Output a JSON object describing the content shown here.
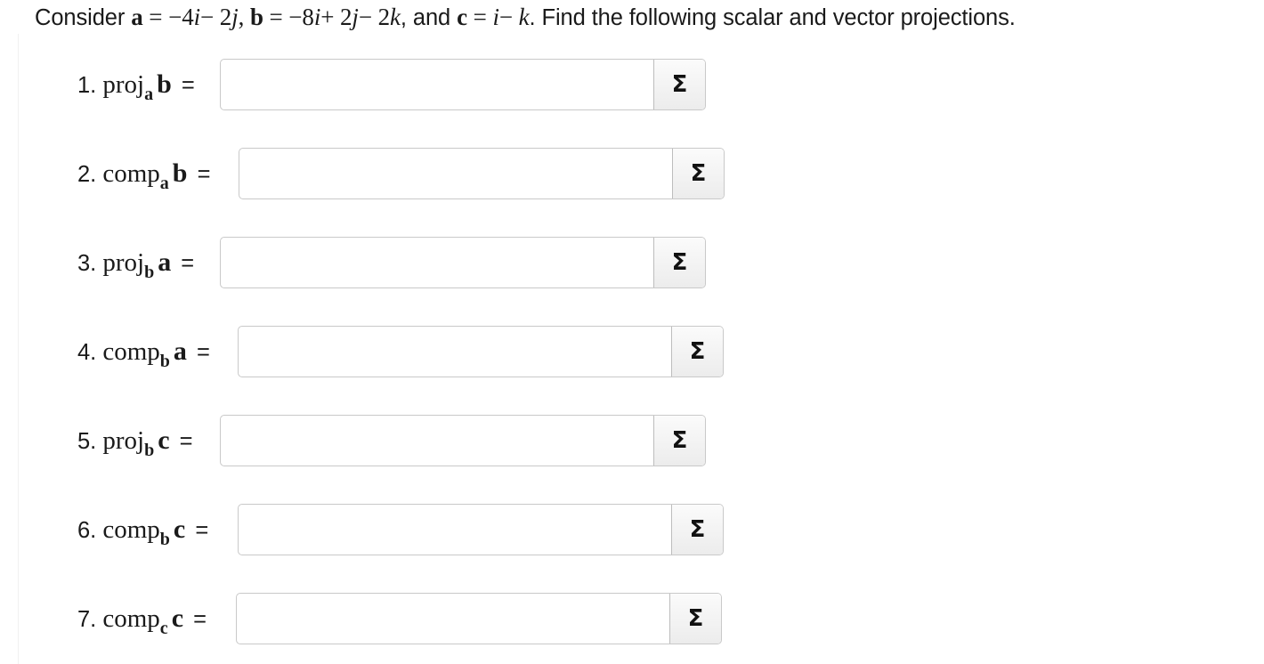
{
  "header": {
    "t1": "Consider ",
    "a": "a",
    "eq1": " = ",
    "a_expr_1": "−4",
    "i1": "i",
    "a_expr_2": "− 2",
    "j1": "j",
    "comma1": ", ",
    "b": "b",
    "eq2": " = ",
    "b_expr_1": "−8",
    "i2": "i",
    "b_expr_2": "+ 2",
    "j2": "j",
    "b_expr_3": "− 2",
    "k1": "k",
    "t2": ", and ",
    "c": "c",
    "eq3": " = ",
    "i3": "i",
    "c_expr_1": "− ",
    "k2": "k",
    "t3": ". Find the following scalar and vector projections."
  },
  "problems": [
    {
      "num": "1. ",
      "fn": "proj",
      "sub": "a",
      "vec": "b",
      "eq": "=",
      "value": ""
    },
    {
      "num": "2. ",
      "fn": "comp",
      "sub": "a",
      "vec": "b",
      "eq": "=",
      "value": ""
    },
    {
      "num": "3. ",
      "fn": "proj",
      "sub": "b",
      "vec": "a",
      "eq": "=",
      "value": ""
    },
    {
      "num": "4. ",
      "fn": "comp",
      "sub": "b",
      "vec": "a",
      "eq": "=",
      "value": ""
    },
    {
      "num": "5. ",
      "fn": "proj",
      "sub": "b",
      "vec": "c",
      "eq": "=",
      "value": ""
    },
    {
      "num": "6. ",
      "fn": "comp",
      "sub": "b",
      "vec": "c",
      "eq": "=",
      "value": ""
    },
    {
      "num": "7. ",
      "fn": "comp",
      "sub": "c",
      "vec": "c",
      "eq": "=",
      "value": ""
    }
  ],
  "sigma_symbol": "Σ",
  "colors": {
    "border": "#c9c9c9",
    "button_bg": "#f2f2f2",
    "text": "#1a1a1a"
  }
}
